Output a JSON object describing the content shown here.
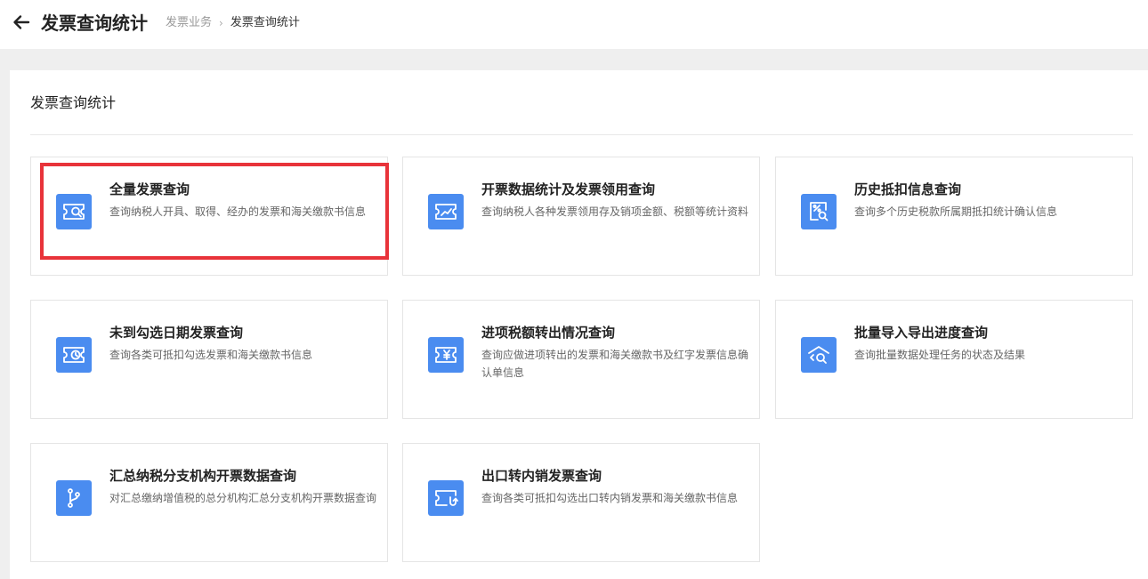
{
  "header": {
    "title": "发票查询统计",
    "breadcrumb": {
      "parent": "发票业务",
      "separator": "›",
      "current": "发票查询统计"
    }
  },
  "section": {
    "title": "发票查询统计"
  },
  "cards": [
    {
      "title": "全量发票查询",
      "desc": "查询纳税人开具、取得、经办的发票和海关缴款书信息",
      "icon": "invoice-search-icon",
      "highlighted": true
    },
    {
      "title": "开票数据统计及发票领用查询",
      "desc": "查询纳税人各种发票领用存及销项金额、税额等统计资料",
      "icon": "invoice-trend-icon"
    },
    {
      "title": "历史抵扣信息查询",
      "desc": "查询多个历史税款所属期抵扣统计确认信息",
      "icon": "percent-search-icon"
    },
    {
      "title": "未到勾选日期发票查询",
      "desc": "查询各类可抵扣勾选发票和海关缴款书信息",
      "icon": "invoice-clock-icon"
    },
    {
      "title": "进项税额转出情况查询",
      "desc": "查询应做进项转出的发票和海关缴款书及红字发票信息确认单信息",
      "icon": "invoice-yen-icon"
    },
    {
      "title": "批量导入导出进度查询",
      "desc": "查询批量数据处理任务的状态及结果",
      "icon": "transfer-search-icon"
    },
    {
      "title": "汇总纳税分支机构开票数据查询",
      "desc": "对汇总缴纳增值税的总分机构汇总分支机构开票数据查询",
      "icon": "branch-icon"
    },
    {
      "title": "出口转内销发票查询",
      "desc": "查询各类可抵扣勾选出口转内销发票和海关缴款书信息",
      "icon": "invoice-return-icon"
    }
  ],
  "colors": {
    "accent": "#4a8cf0",
    "highlight": "#e8333a"
  }
}
